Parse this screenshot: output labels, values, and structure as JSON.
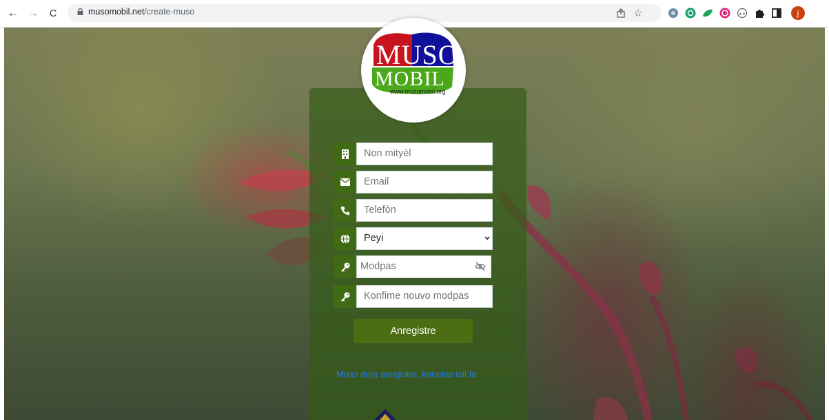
{
  "browser": {
    "url_domain": "musomobil.net",
    "url_path": "/create-muso",
    "icons": [
      "back-icon",
      "forward-icon",
      "reload-icon",
      "lock-icon",
      "share-icon",
      "star-icon",
      "extension-icons",
      "puzzle-icon",
      "sidebar-icon",
      "avatar"
    ],
    "profile_initial": "j"
  },
  "logo": {
    "top_text": "MUSO",
    "bottom_text": "MOBIL",
    "site": "www.musomobil.org",
    "colors": {
      "red": "#c8141e",
      "blue": "#10109a",
      "green": "#4aa81a"
    }
  },
  "form": {
    "name_placeholder": "Non mityèl",
    "email_placeholder": "Email",
    "phone_placeholder": "Telefòn",
    "country_selected": "Peyi",
    "password_placeholder": "Modpas",
    "confirm_placeholder": "Konfime nouvo modpas",
    "submit_label": "Anregistre",
    "login_link": "Muso deja anrejistre, konekte isit la"
  },
  "colors": {
    "panel": "#325c16",
    "icon_bg": "#416a15",
    "button": "#4c6e12",
    "link": "#1d7bff"
  }
}
